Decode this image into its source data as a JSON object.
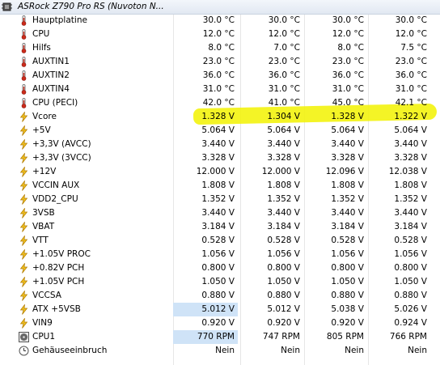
{
  "header": {
    "title": "ASRock Z790 Pro RS (Nuvoton N..."
  },
  "colors": {
    "highlight": "#f2f200",
    "selected_cell": "#cfe3f7",
    "thermometer_red": "#cc2a1a",
    "bolt_yellow": "#f0c020"
  },
  "rows": [
    {
      "label": "Hauptplatine",
      "icon": "thermometer-icon",
      "values": [
        "30.0 °C",
        "30.0 °C",
        "30.0 °C",
        "30.0 °C"
      ]
    },
    {
      "label": "CPU",
      "icon": "thermometer-icon",
      "values": [
        "12.0 °C",
        "12.0 °C",
        "12.0 °C",
        "12.0 °C"
      ]
    },
    {
      "label": "Hilfs",
      "icon": "thermometer-icon",
      "values": [
        "8.0 °C",
        "7.0 °C",
        "8.0 °C",
        "7.5 °C"
      ]
    },
    {
      "label": "AUXTIN1",
      "icon": "thermometer-icon",
      "values": [
        "23.0 °C",
        "23.0 °C",
        "23.0 °C",
        "23.0 °C"
      ]
    },
    {
      "label": "AUXTIN2",
      "icon": "thermometer-icon",
      "values": [
        "36.0 °C",
        "36.0 °C",
        "36.0 °C",
        "36.0 °C"
      ]
    },
    {
      "label": "AUXTIN4",
      "icon": "thermometer-icon",
      "values": [
        "31.0 °C",
        "31.0 °C",
        "31.0 °C",
        "31.0 °C"
      ]
    },
    {
      "label": "CPU (PECI)",
      "icon": "thermometer-icon",
      "values": [
        "42.0 °C",
        "41.0 °C",
        "45.0 °C",
        "42.1 °C"
      ]
    },
    {
      "label": "Vcore",
      "icon": "bolt-icon",
      "values": [
        "1.328 V",
        "1.304 V",
        "1.328 V",
        "1.322 V"
      ]
    },
    {
      "label": "+5V",
      "icon": "bolt-icon",
      "values": [
        "5.064 V",
        "5.064 V",
        "5.064 V",
        "5.064 V"
      ]
    },
    {
      "label": "+3,3V (AVCC)",
      "icon": "bolt-icon",
      "values": [
        "3.440 V",
        "3.440 V",
        "3.440 V",
        "3.440 V"
      ]
    },
    {
      "label": "+3,3V (3VCC)",
      "icon": "bolt-icon",
      "values": [
        "3.328 V",
        "3.328 V",
        "3.328 V",
        "3.328 V"
      ]
    },
    {
      "label": "+12V",
      "icon": "bolt-icon",
      "values": [
        "12.000 V",
        "12.000 V",
        "12.096 V",
        "12.038 V"
      ]
    },
    {
      "label": "VCCIN AUX",
      "icon": "bolt-icon",
      "values": [
        "1.808 V",
        "1.808 V",
        "1.808 V",
        "1.808 V"
      ]
    },
    {
      "label": "VDD2_CPU",
      "icon": "bolt-icon",
      "values": [
        "1.352 V",
        "1.352 V",
        "1.352 V",
        "1.352 V"
      ]
    },
    {
      "label": "3VSB",
      "icon": "bolt-icon",
      "values": [
        "3.440 V",
        "3.440 V",
        "3.440 V",
        "3.440 V"
      ]
    },
    {
      "label": "VBAT",
      "icon": "bolt-icon",
      "values": [
        "3.184 V",
        "3.184 V",
        "3.184 V",
        "3.184 V"
      ]
    },
    {
      "label": "VTT",
      "icon": "bolt-icon",
      "values": [
        "0.528 V",
        "0.528 V",
        "0.528 V",
        "0.528 V"
      ]
    },
    {
      "label": "+1.05V PROC",
      "icon": "bolt-icon",
      "values": [
        "1.056 V",
        "1.056 V",
        "1.056 V",
        "1.056 V"
      ]
    },
    {
      "label": "+0.82V PCH",
      "icon": "bolt-icon",
      "values": [
        "0.800 V",
        "0.800 V",
        "0.800 V",
        "0.800 V"
      ]
    },
    {
      "label": "+1.05V PCH",
      "icon": "bolt-icon",
      "values": [
        "1.050 V",
        "1.050 V",
        "1.050 V",
        "1.050 V"
      ]
    },
    {
      "label": "VCCSA",
      "icon": "bolt-icon",
      "values": [
        "0.880 V",
        "0.880 V",
        "0.880 V",
        "0.880 V"
      ]
    },
    {
      "label": "ATX +5VSB",
      "icon": "bolt-icon",
      "values": [
        "5.012 V",
        "5.012 V",
        "5.038 V",
        "5.026 V"
      ]
    },
    {
      "label": "VIN9",
      "icon": "bolt-icon",
      "values": [
        "0.920 V",
        "0.920 V",
        "0.920 V",
        "0.924 V"
      ]
    },
    {
      "label": "CPU1",
      "icon": "fan-icon",
      "values": [
        "770 RPM",
        "747 RPM",
        "805 RPM",
        "766 RPM"
      ]
    },
    {
      "label": "Gehäuseeinbruch",
      "icon": "clock-icon",
      "values": [
        "Nein",
        "Nein",
        "Nein",
        "Nein"
      ]
    }
  ]
}
